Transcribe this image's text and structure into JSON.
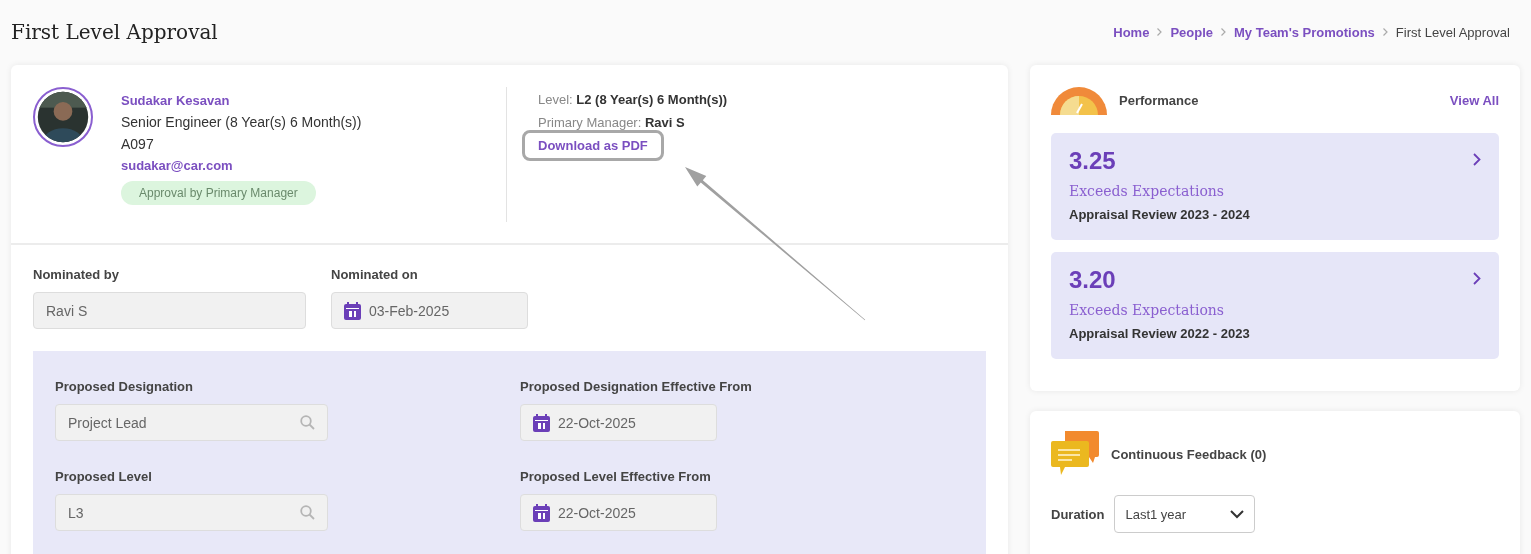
{
  "page_title": "First Level Approval",
  "breadcrumb": [
    {
      "label": "Home",
      "current": false
    },
    {
      "label": "People",
      "current": false
    },
    {
      "label": "My Team's Promotions",
      "current": false
    },
    {
      "label": "First Level Approval",
      "current": true
    }
  ],
  "employee": {
    "name": "Sudakar Kesavan",
    "designation": "Senior Engineer (8 Year(s) 6 Month(s))",
    "code": "A097",
    "email": "sudakar@car.com",
    "status_badge": "Approval by Primary Manager",
    "level_label": "Level:",
    "level_value": "L2 (8 Year(s) 6 Month(s))",
    "manager_label": "Primary Manager:",
    "manager_value": "Ravi S",
    "download_link": "Download as PDF"
  },
  "nomination": [
    {
      "label": "Nominated by",
      "value": "Ravi S",
      "kind": "text"
    },
    {
      "label": "Nominated on",
      "value": "03-Feb-2025",
      "kind": "date"
    }
  ],
  "proposal": [
    {
      "label": "Proposed Designation",
      "value": "Project Lead",
      "kind": "search"
    },
    {
      "label": "Proposed Designation Effective From",
      "value": "22-Oct-2025",
      "kind": "date"
    },
    {
      "label": "Proposed Level",
      "value": "L3",
      "kind": "search"
    },
    {
      "label": "Proposed Level Effective From",
      "value": "22-Oct-2025",
      "kind": "date"
    }
  ],
  "performance": {
    "title": "Performance",
    "view_all": "View All",
    "reviews": [
      {
        "score": "3.25",
        "rating": "Exceeds Expectations",
        "review": "Appraisal Review 2023 - 2024"
      },
      {
        "score": "3.20",
        "rating": "Exceeds Expectations",
        "review": "Appraisal Review 2022 - 2023"
      }
    ]
  },
  "feedback": {
    "title": "Continuous Feedback (0)",
    "duration_label": "Duration",
    "duration_value": "Last1 year"
  }
}
